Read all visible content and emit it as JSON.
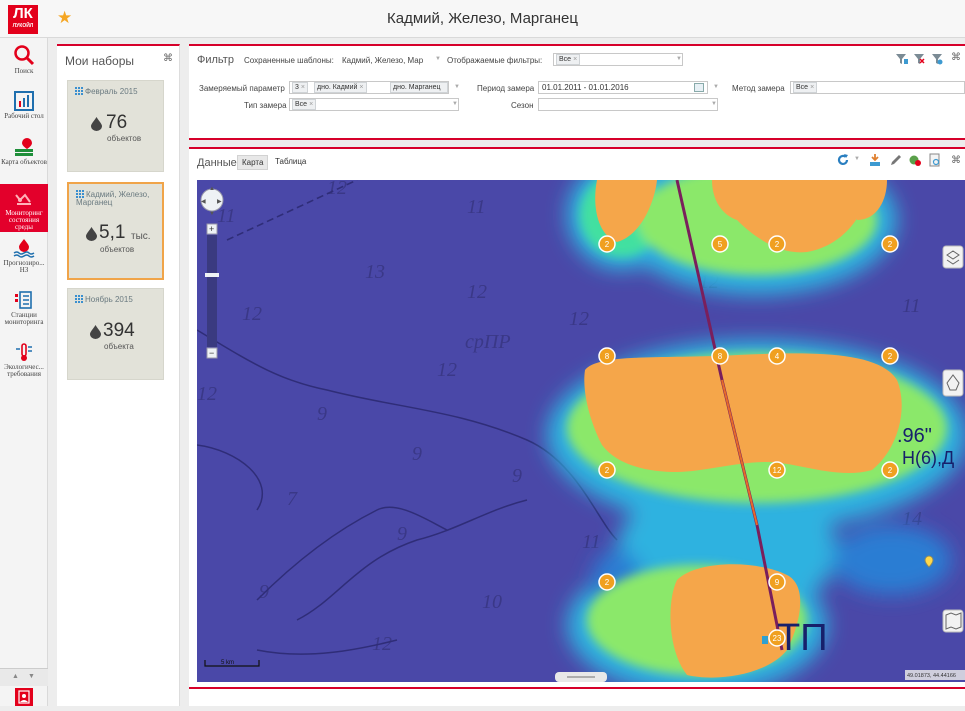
{
  "header": {
    "logo_text": "ЛУКОЙЛ",
    "title": "Кадмий, Железо, Марганец"
  },
  "nav": {
    "items": [
      {
        "label": "Поиск",
        "icon": "search-icon"
      },
      {
        "label": "Рабочий стол",
        "icon": "chart-icon"
      },
      {
        "label": "Карта объектов",
        "icon": "map-objects-icon"
      },
      {
        "label": "Мониторинг состояния среды",
        "icon": "monitoring-icon"
      },
      {
        "label": "Прогнозиро... НЗ",
        "icon": "forecast-icon"
      },
      {
        "label": "Станции мониторинга",
        "icon": "station-icon"
      },
      {
        "label": "Экологичес... требования",
        "icon": "thermometer-icon"
      }
    ],
    "colors": {
      "accent": "#e3002b",
      "icon_red": "#e3001b",
      "icon_blue": "#1f6fae"
    }
  },
  "sets": {
    "title": "Мои наборы",
    "cards": [
      {
        "name": "Февраль 2015",
        "count": "76",
        "unit": "объектов",
        "selected": false
      },
      {
        "name": "Кадмий, Железо, Марганец",
        "count": "5,1",
        "count_suffix": "тыс.",
        "unit": "объектов",
        "selected": true
      },
      {
        "name": "Ноябрь 2015",
        "count": "394",
        "unit": "объекта",
        "selected": false
      }
    ]
  },
  "filter": {
    "title": "Фильтр",
    "saved_templates_label": "Сохраненные шаблоны:",
    "saved_templates_value": "Кадмий, Железо, Мар",
    "displayed_filters_label": "Отображаемые фильтры:",
    "displayed_filters_value": "Все",
    "measured_param_label": "Замеряемый параметр",
    "measured_param_chips": [
      "3",
      "дно. Кадмий",
      "дно. Марганец"
    ],
    "period_label": "Период замера",
    "period_value": "01.01.2011 - 01.01.2016",
    "method_label": "Метод замера",
    "method_value": "Все",
    "type_label": "Тип замера",
    "type_value": "Все",
    "season_label": "Сезон",
    "season_value": ""
  },
  "data_panel": {
    "title": "Данные",
    "tabs": [
      "Карта",
      "Таблица"
    ],
    "active_tab": "Карта"
  },
  "map": {
    "scale_label": "5 km",
    "coordinates": "49.01873, 44.44166",
    "clusters": [
      "2",
      "5",
      "2",
      "2",
      "8",
      "8",
      "4",
      "2",
      "2",
      "12",
      "2",
      "2",
      "9",
      "23"
    ],
    "colors": {
      "base": "#4a48a8",
      "hot": "#f5a64a",
      "cluster": "#f0a020"
    }
  }
}
